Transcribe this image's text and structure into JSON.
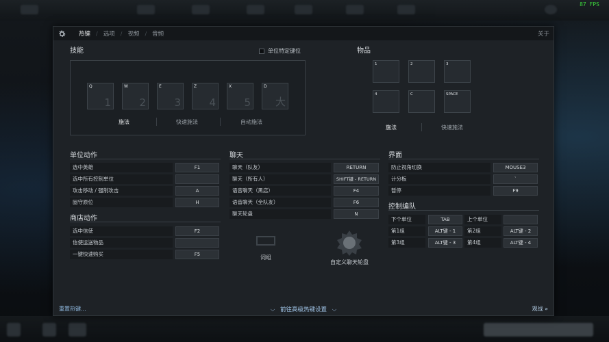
{
  "fps": "87 FPS",
  "header": {
    "tabs": [
      {
        "label": "热键"
      },
      {
        "label": "选项"
      },
      {
        "label": "视频"
      },
      {
        "label": "音频"
      }
    ],
    "separator": "/",
    "about": "关于"
  },
  "skills": {
    "title": "技能",
    "unit_specific": "单位特定键位",
    "slots": [
      {
        "key": "Q",
        "num": "1"
      },
      {
        "key": "W",
        "num": "2"
      },
      {
        "key": "E",
        "num": "3"
      },
      {
        "key": "Z",
        "num": "4"
      },
      {
        "key": "X",
        "num": "5"
      },
      {
        "key": "D",
        "num": "大"
      }
    ],
    "modes": [
      "施法",
      "快速施法",
      "自动施法"
    ]
  },
  "items": {
    "title": "物品",
    "slots": [
      "1",
      "2",
      "3",
      "4",
      "C",
      "SPACE"
    ],
    "modes": [
      "施法",
      "快速施法"
    ]
  },
  "unit_actions": {
    "title": "单位动作",
    "rows": [
      {
        "label": "选中英雄",
        "key": "F1"
      },
      {
        "label": "选中所有控制单位",
        "key": ""
      },
      {
        "label": "攻击移动 / 强制攻击",
        "key": "A"
      },
      {
        "label": "固守原位",
        "key": "H"
      }
    ]
  },
  "shop_actions": {
    "title": "商店动作",
    "rows": [
      {
        "label": "选中信使",
        "key": "F2"
      },
      {
        "label": "信使运送物品",
        "key": ""
      },
      {
        "label": "一键快速购买",
        "key": "F5"
      }
    ]
  },
  "chat": {
    "title": "聊天",
    "rows": [
      {
        "label": "聊天（队友）",
        "key": "RETURN"
      },
      {
        "label": "聊天（所有人）",
        "key": "SHIFT键 - RETURN"
      },
      {
        "label": "语音聊天（黑店）",
        "key": "F4"
      },
      {
        "label": "语音聊天（全队友）",
        "key": "F6"
      },
      {
        "label": "聊天轮盘",
        "key": "N"
      }
    ],
    "phrase_label": "词组",
    "wheel_label": "自定义聊天轮盘"
  },
  "interface": {
    "title": "界面",
    "rows": [
      {
        "label": "防止视角切换",
        "key": "MOUSE3"
      },
      {
        "label": "计分板",
        "key": "`"
      },
      {
        "label": "暂停",
        "key": "F9"
      }
    ]
  },
  "control_groups": {
    "title": "控制编队",
    "rows": [
      [
        {
          "label": "下个单位",
          "key": "TAB"
        },
        {
          "label": "上个单位",
          "key": ""
        }
      ],
      [
        {
          "label": "第1组",
          "key": "ALT键 - 1"
        },
        {
          "label": "第2组",
          "key": "ALT键 - 2"
        }
      ],
      [
        {
          "label": "第3组",
          "key": "ALT键 - 3"
        },
        {
          "label": "第4组",
          "key": "ALT键 - 4"
        }
      ]
    ]
  },
  "footer": {
    "reset": "重置热键...",
    "advanced": "前往高级热键设置",
    "spectate": "观战"
  },
  "colors": {
    "link": "#8fb8de",
    "fps": "#3bd43b",
    "panel": "#1e2226"
  }
}
